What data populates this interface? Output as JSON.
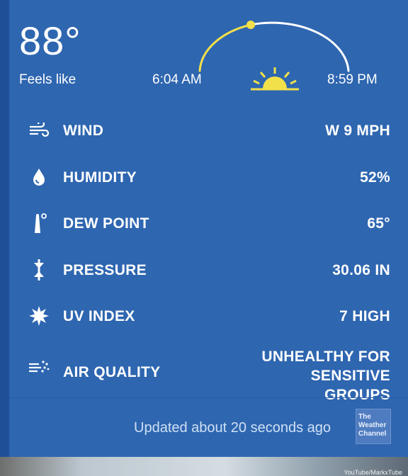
{
  "current": {
    "temperature": "88°",
    "feels_like_label": "Feels like"
  },
  "sun": {
    "sunrise": "6:04 AM",
    "sunset": "8:59 PM",
    "arc_color": "#f2e04a",
    "remaining_color": "#ffffff"
  },
  "details": [
    {
      "icon": "wind-icon",
      "label": "WIND",
      "value": "W 9 MPH"
    },
    {
      "icon": "droplet-icon",
      "label": "HUMIDITY",
      "value": "52%"
    },
    {
      "icon": "thermometer-icon",
      "label": "DEW POINT",
      "value": "65°"
    },
    {
      "icon": "pressure-icon",
      "label": "PRESSURE",
      "value": "30.06 IN"
    },
    {
      "icon": "uv-sun-icon",
      "label": "UV INDEX",
      "value": "7 HIGH"
    },
    {
      "icon": "air-quality-icon",
      "label": "AIR QUALITY",
      "value_line1": "UNHEALTHY FOR SENSITIVE",
      "value_line2": "GROUPS"
    }
  ],
  "footer": {
    "updated": "Updated about 20 seconds ago",
    "logo_line1": "The",
    "logo_line2": "Weather",
    "logo_line3": "Channel"
  },
  "watermark": "YouTube/MarkxTube",
  "colors": {
    "background": "#2e66b0",
    "text": "#ffffff",
    "sun": "#f2e04a"
  }
}
